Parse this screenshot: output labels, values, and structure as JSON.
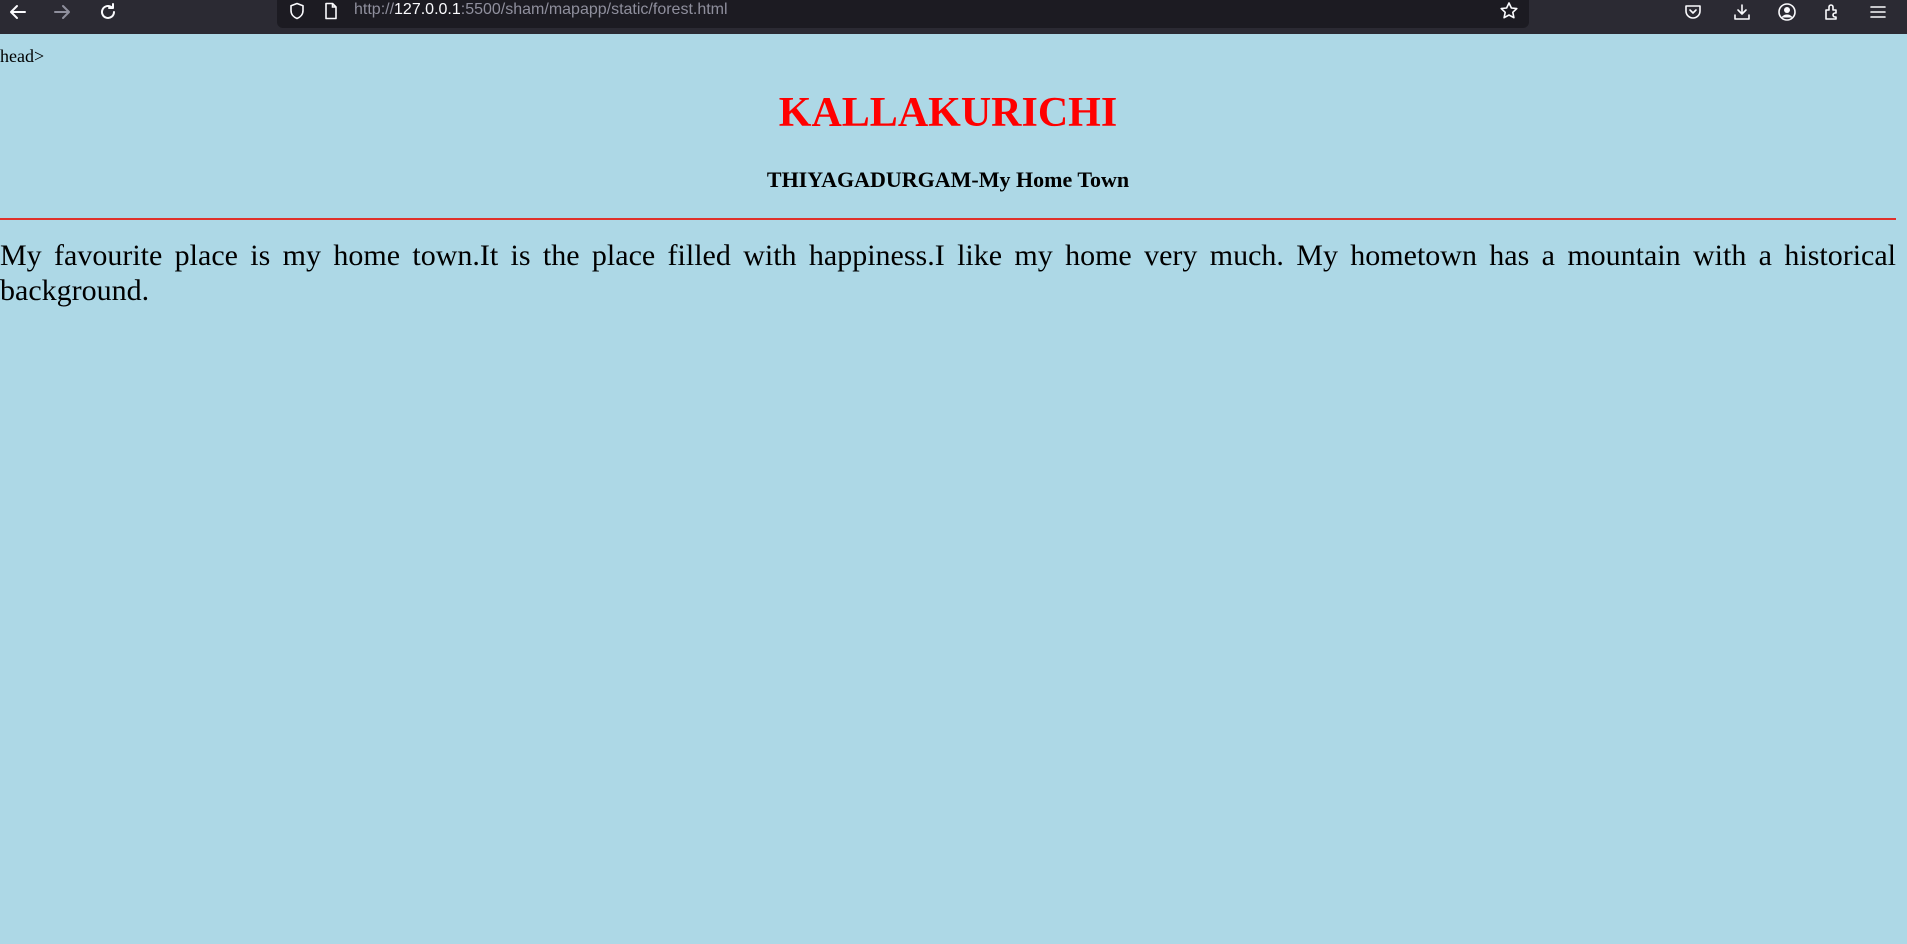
{
  "browser": {
    "url_prefix": "http://",
    "url_host": "127.0.0.1",
    "url_rest": ":5500/sham/mapapp/static/forest.html",
    "icons": [
      "back-icon",
      "forward-icon",
      "reload-icon",
      "shield-icon",
      "page-icon",
      "star-icon",
      "pocket-icon",
      "download-icon",
      "account-icon",
      "extensions-icon",
      "menu-icon"
    ]
  },
  "page": {
    "stray_text": "head>",
    "title": "KALLAKURICHI",
    "subtitle": "THIYAGADURGAM-My Home Town",
    "paragraph": "My favourite place is my home town.It is the place filled with happiness.I like my home very much. My hometown has a mountain with a historical background.",
    "background_color": "#add8e6",
    "title_color": "#ff0000",
    "rule_color": "#e0312b"
  }
}
